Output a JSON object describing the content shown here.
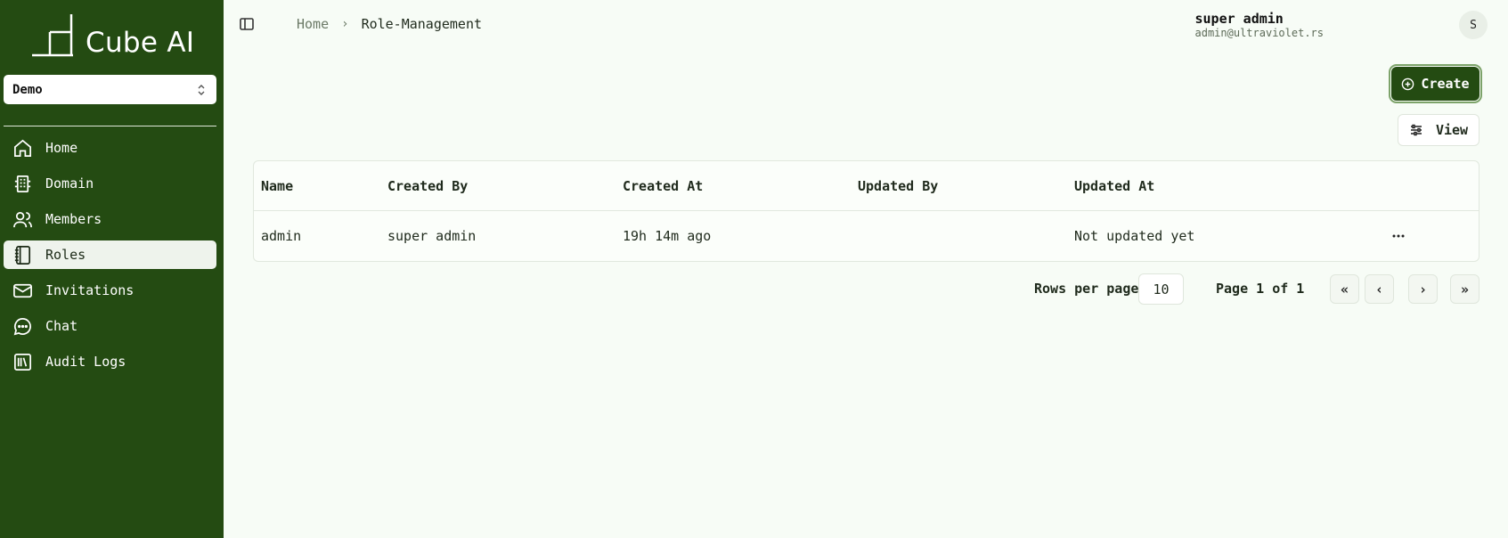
{
  "app": {
    "logo_text": "Cube AI",
    "workspace_selected": "Demo"
  },
  "sidebar": {
    "items": [
      {
        "label": "Home",
        "icon": "home-icon"
      },
      {
        "label": "Domain",
        "icon": "domain-icon"
      },
      {
        "label": "Members",
        "icon": "members-icon"
      },
      {
        "label": "Roles",
        "icon": "roles-icon",
        "active": true
      },
      {
        "label": "Invitations",
        "icon": "mail-icon"
      },
      {
        "label": "Chat",
        "icon": "chat-icon"
      },
      {
        "label": "Audit Logs",
        "icon": "library-icon"
      }
    ]
  },
  "header": {
    "breadcrumb_home": "Home",
    "breadcrumb_current": "Role-Management",
    "user_name": "super admin",
    "user_email": "admin@ultraviolet.rs",
    "avatar_initial": "S"
  },
  "actions": {
    "create_label": "Create",
    "view_label": "View"
  },
  "table": {
    "columns": [
      "Name",
      "Created By",
      "Created At",
      "Updated By",
      "Updated At"
    ],
    "rows": [
      {
        "name": "admin",
        "created_by": "super admin",
        "created_at": "19h 14m ago",
        "updated_by": "",
        "updated_at": "Not updated yet"
      }
    ]
  },
  "pagination": {
    "rows_per_page_label": "Rows per page",
    "rows_per_page_value": "10",
    "page_label": "Page 1 of 1"
  },
  "colors": {
    "sidebar_bg": "#244b12",
    "page_bg": "#f7fcf6",
    "accent": "#244b12"
  }
}
